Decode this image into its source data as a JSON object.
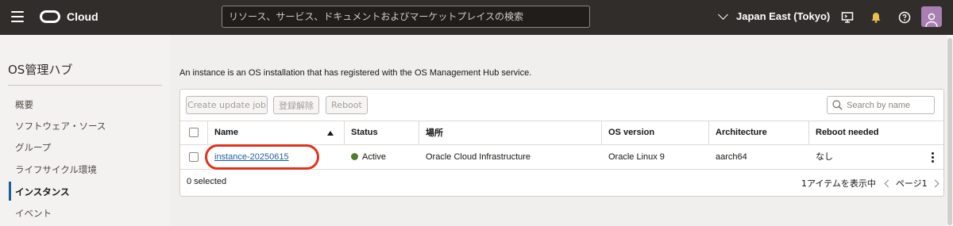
{
  "topbar": {
    "app_name": "Cloud",
    "search_placeholder": "リソース、サービス、ドキュメントおよびマーケットプレイスの検索",
    "region": "Japan East (Tokyo)"
  },
  "leftnav": {
    "title": "OS管理ハブ",
    "items": [
      {
        "label": "概要"
      },
      {
        "label": "ソフトウェア・ソース"
      },
      {
        "label": "グループ"
      },
      {
        "label": "ライフサイクル環境"
      },
      {
        "label": "インスタンス"
      },
      {
        "label": "イベント"
      }
    ],
    "active": "インスタンス"
  },
  "main": {
    "intro": "An instance is an OS installation that has registered with the OS Management Hub service.",
    "toolbar": {
      "create_update_job": "Create update job",
      "unregister": "登録解除",
      "reboot": "Reboot",
      "search_placeholder": "Search by name"
    },
    "table": {
      "headers": [
        "Name",
        "Status",
        "場所",
        "OS version",
        "Architecture",
        "Reboot needed"
      ],
      "rows": [
        {
          "name": "instance-20250615",
          "status": "Active",
          "location": "Oracle Cloud Infrastructure",
          "os_version": "Oracle Linux 9",
          "architecture": "aarch64",
          "reboot_needed": "なし"
        }
      ]
    },
    "footer": {
      "selected": "0 selected",
      "items_shown": "1アイテムを表示中",
      "page": "ページ1"
    }
  },
  "colors": {
    "topbar_bg": "#312d2a",
    "link": "#1f5d99",
    "status_active": "#4e7e2b",
    "highlight": "#e0331e"
  }
}
